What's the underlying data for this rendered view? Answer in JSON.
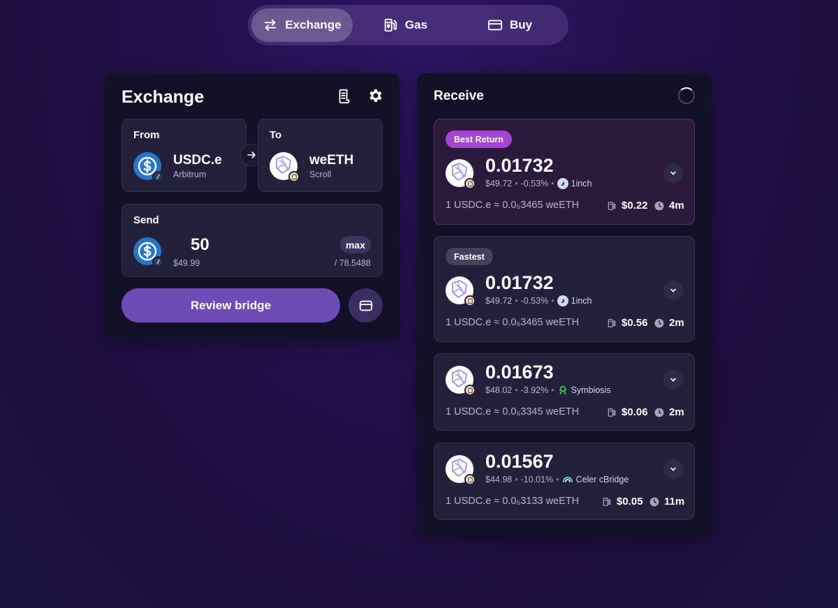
{
  "nav": {
    "tabs": [
      {
        "label": "Exchange",
        "icon": "swap-arrows-icon",
        "active": true
      },
      {
        "label": "Gas",
        "icon": "gas-pump-icon",
        "active": false
      },
      {
        "label": "Buy",
        "icon": "credit-card-icon",
        "active": false
      }
    ]
  },
  "exchange": {
    "title": "Exchange",
    "from": {
      "label": "From",
      "token": "USDC.e",
      "chain": "Arbitrum"
    },
    "to": {
      "label": "To",
      "token": "weETH",
      "chain": "Scroll"
    },
    "send": {
      "label": "Send",
      "amount": "50",
      "usd": "$49.99",
      "max_label": "max",
      "balance": "/ 78.5488"
    },
    "review_label": "Review bridge"
  },
  "receive": {
    "title": "Receive",
    "routes": [
      {
        "tag": "Best Return",
        "amount": "0.01732",
        "usd": "$49.72",
        "change": "-0.53%",
        "provider": "1inch",
        "rate": "1 USDC.e ≈ 0.0₅3465 weETH",
        "gas": "$0.22",
        "time": "4m"
      },
      {
        "tag": "Fastest",
        "amount": "0.01732",
        "usd": "$49.72",
        "change": "-0.53%",
        "provider": "1inch",
        "rate": "1 USDC.e ≈ 0.0₅3465 weETH",
        "gas": "$0.56",
        "time": "2m"
      },
      {
        "tag": "",
        "amount": "0.01673",
        "usd": "$48.02",
        "change": "-3.92%",
        "provider": "Symbiosis",
        "rate": "1 USDC.e ≈ 0.0₅3345 weETH",
        "gas": "$0.06",
        "time": "2m"
      },
      {
        "tag": "",
        "amount": "0.01567",
        "usd": "$44.98",
        "change": "-10.01%",
        "provider": "Celer cBridge",
        "rate": "1 USDC.e ≈ 0.0₅3133 weETH",
        "gas": "$0.05",
        "time": "11m"
      }
    ]
  },
  "colors": {
    "accent": "#6f4bb5",
    "best_tag": "#a346d2",
    "panel": "#121026",
    "card": "#23203b"
  }
}
